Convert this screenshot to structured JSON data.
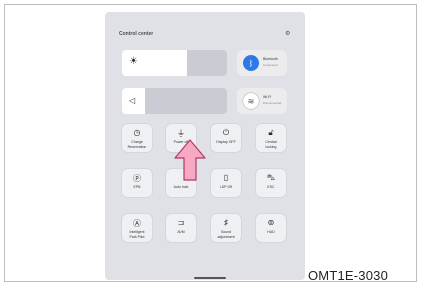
{
  "figure_code": "OMT1E-3030",
  "control_center": {
    "title": "Control center",
    "settings_icon": "gear-icon",
    "brightness_icon": "sun-icon",
    "brightness_level": 0.62,
    "volume_icon": "speaker-icon",
    "volume_level": 0.22,
    "bluetooth": {
      "label": "Bluetooth",
      "status": "Connected",
      "icon": "bluetooth-icon",
      "color": "#2d7ae6"
    },
    "wifi": {
      "label": "Wi-Fi",
      "status": "Disconnected",
      "icon": "wifi-icon",
      "color": "#8a8d93"
    },
    "tiles": [
      {
        "icon": "charge-icon",
        "label": "Charge\nReservation"
      },
      {
        "icon": "power-plug-icon",
        "label": "Power off"
      },
      {
        "icon": "power-icon",
        "label": "Display OFF"
      },
      {
        "icon": "lock-icon",
        "label": "Central\nlocking"
      },
      {
        "icon": "eco-icon",
        "label": "EPB"
      },
      {
        "icon": "",
        "label": "Auto hold"
      },
      {
        "icon": "battery-icon",
        "label": "i-DP Off"
      },
      {
        "icon": "car-icon",
        "label": "ESC"
      },
      {
        "icon": "parking-icon",
        "label": "Intelligent\nPark Pilot"
      },
      {
        "icon": "mirror-icon",
        "label": "AVM"
      },
      {
        "icon": "sound-icon",
        "label": "Sound\nadjustment"
      },
      {
        "icon": "steering-icon",
        "label": "HUD"
      }
    ]
  }
}
